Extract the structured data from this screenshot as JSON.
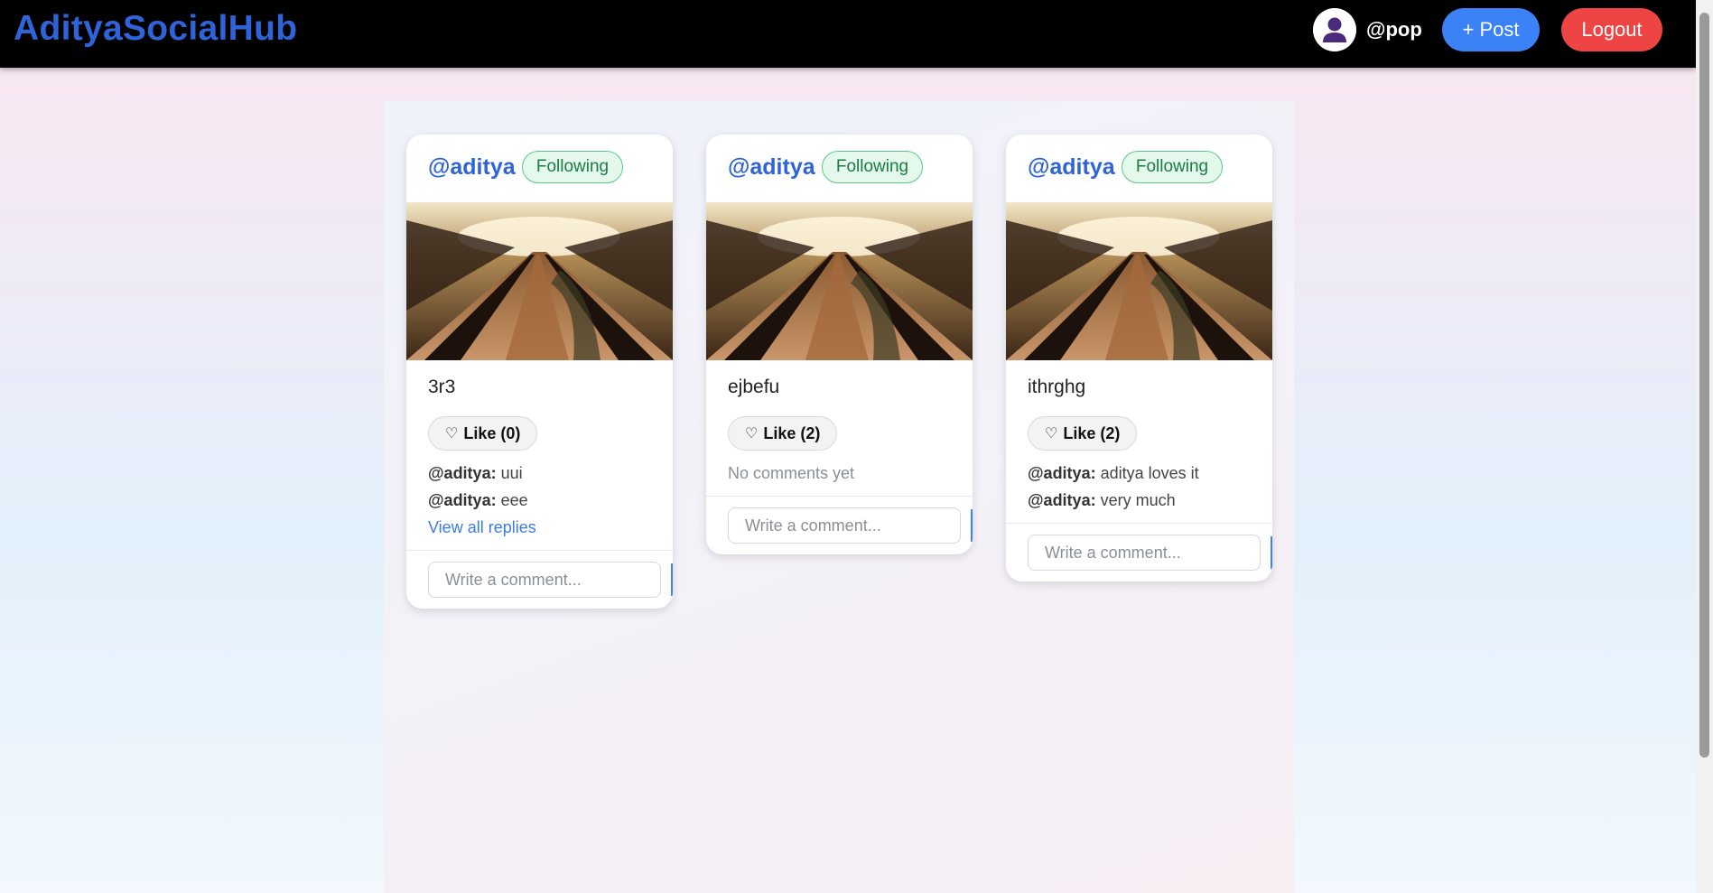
{
  "header": {
    "brand": "AdityaSocialHub",
    "username": "@pop",
    "post_button": "+ Post",
    "logout_button": "Logout"
  },
  "posts": [
    {
      "author": "@aditya",
      "follow_status": "Following",
      "caption": "3r3",
      "like_label": "Like (0)",
      "comments": [
        {
          "author": "@aditya:",
          "text": "uui"
        },
        {
          "author": "@aditya:",
          "text": "eee"
        }
      ],
      "view_all": "View all replies",
      "comment_placeholder": "Write a comment..."
    },
    {
      "author": "@aditya",
      "follow_status": "Following",
      "caption": "ejbefu",
      "like_label": "Like (2)",
      "no_comments": "No comments yet",
      "comment_placeholder": "Write a comment..."
    },
    {
      "author": "@aditya",
      "follow_status": "Following",
      "caption": "ithrghg",
      "like_label": "Like (2)",
      "comments": [
        {
          "author": "@aditya:",
          "text": "aditya loves it"
        },
        {
          "author": "@aditya:",
          "text": "very much"
        }
      ],
      "comment_placeholder": "Write a comment..."
    }
  ],
  "icons": {
    "avatar": "user-avatar-icon",
    "like": "heart-outline-icon"
  },
  "colors": {
    "brand": "#2f63d8",
    "post_button": "#3b82f6",
    "logout_button": "#ef4444",
    "following_badge": "#e5f8ec"
  }
}
